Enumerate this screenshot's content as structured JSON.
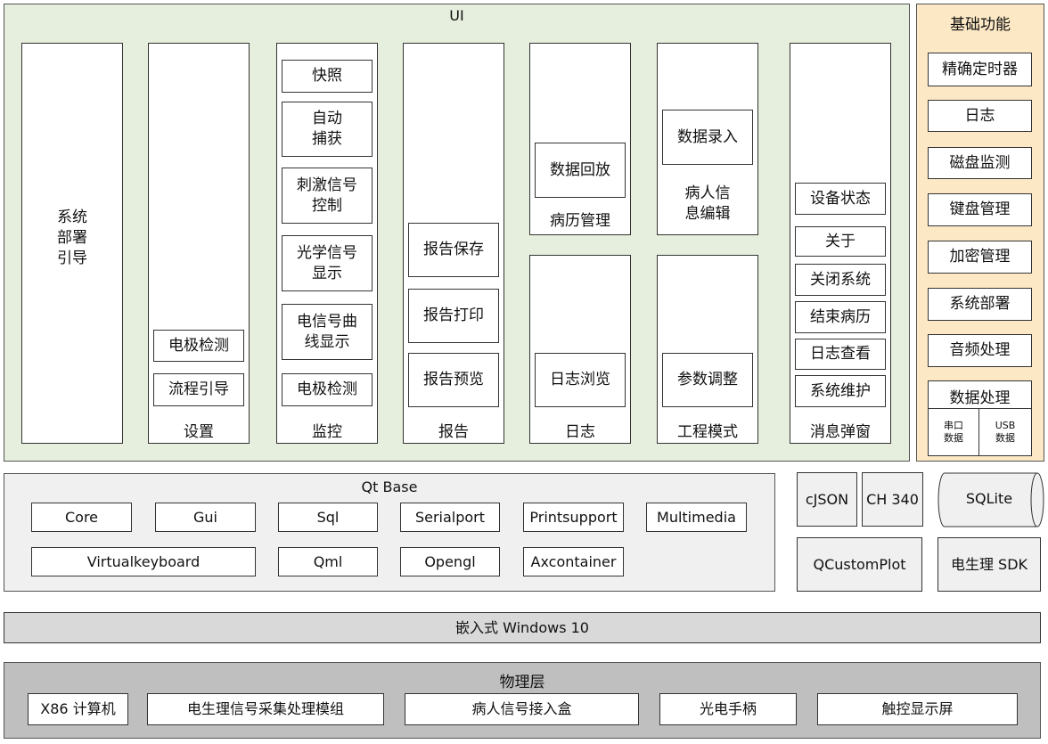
{
  "ui": {
    "title": "UI",
    "col_system": "系统\n部署\n引导",
    "settings": {
      "label": "设置",
      "items": [
        "电极检测",
        "流程引导"
      ]
    },
    "monitor": {
      "label": "监控",
      "items": [
        "快照",
        "自动\n捕获",
        "刺激信号\n控制",
        "光学信号\n显示",
        "电信号曲\n线显示",
        "电极检测"
      ]
    },
    "report": {
      "label": "报告",
      "items": [
        "报告保存",
        "报告打印",
        "报告预览"
      ]
    },
    "records": {
      "label": "病历管理",
      "item": "数据回放"
    },
    "log": {
      "label": "日志",
      "item": "日志浏览"
    },
    "patient": {
      "label": "病人信\n息编辑",
      "item": "数据录入"
    },
    "engineering": {
      "label": "工程模式",
      "item": "参数调整"
    },
    "popup": {
      "label": "消息弹窗",
      "items": [
        "设备状态",
        "关于",
        "关闭系统",
        "结束病历",
        "日志查看",
        "系统维护"
      ]
    }
  },
  "basic": {
    "title": "基础功能",
    "items": [
      "精确定时器",
      "日志",
      "磁盘监测",
      "键盘管理",
      "加密管理",
      "系统部署",
      "音频处理"
    ],
    "data": {
      "label": "数据处理",
      "sub": [
        "串口\n数据",
        "USB\n数据"
      ]
    }
  },
  "qt": {
    "title": "Qt Base",
    "row1": [
      "Core",
      "Gui",
      "Sql",
      "Serialport",
      "Printsupport",
      "Multimedia"
    ],
    "row2": [
      "Virtualkeyboard",
      "Qml",
      "Opengl",
      "Axcontainer"
    ]
  },
  "libs": {
    "cjson": "cJSON",
    "ch340": "CH 340",
    "sqlite": "SQLite",
    "qcustomplot": "QCustomPlot",
    "sdk": "电生理 SDK"
  },
  "os": {
    "label": "嵌入式 Windows 10"
  },
  "physical": {
    "title": "物理层",
    "items": [
      "X86 计算机",
      "电生理信号采集处理模组",
      "病人信号接入盒",
      "光电手柄",
      "触控显示屏"
    ]
  },
  "colors": {
    "ui_bg": "#e6efdd",
    "basic_bg": "#fce8c4",
    "qt_bg": "#f0f0f0",
    "os_bg": "#d9d9d9",
    "phys_bg": "#bfbfbf"
  }
}
